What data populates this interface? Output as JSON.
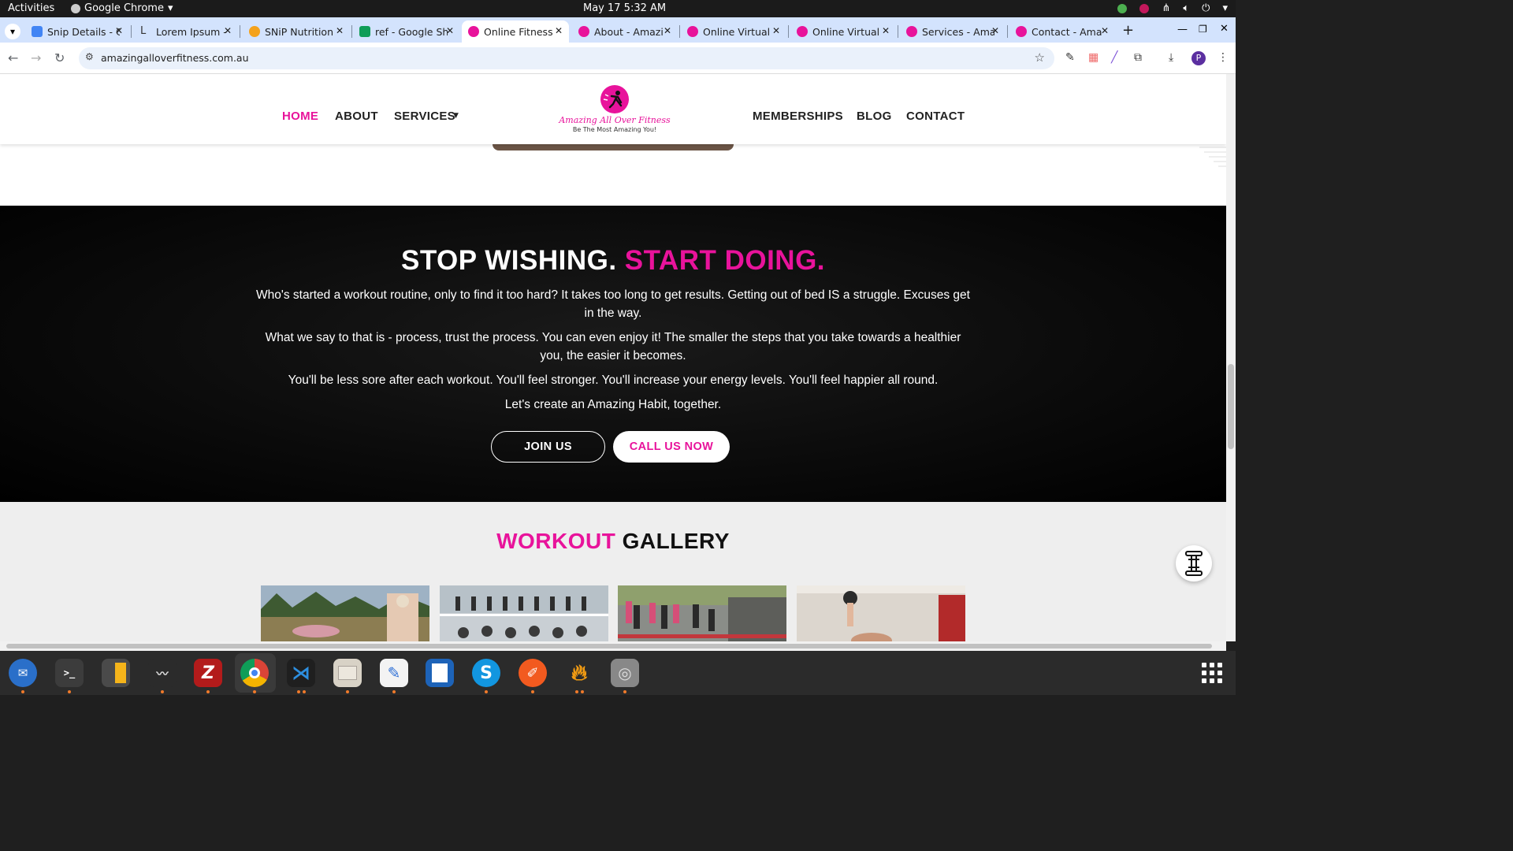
{
  "system": {
    "activities": "Activities",
    "app_name": "Google Chrome",
    "clock": "May 17  5:32 AM"
  },
  "browser": {
    "tabs": [
      {
        "title": "Snip Details - C",
        "icon": "docs-icon",
        "color": "#4285f4"
      },
      {
        "title": "Lorem Ipsum -",
        "icon": "lorem-icon",
        "color": "#555555"
      },
      {
        "title": "SNiP Nutrition",
        "icon": "snip-icon",
        "color": "#f4a21c"
      },
      {
        "title": "ref - Google Sh",
        "icon": "sheets-icon",
        "color": "#0f9d58"
      },
      {
        "title": "Online Fitness",
        "icon": "site-icon",
        "color": "#e8139b"
      },
      {
        "title": "About - Amazi",
        "icon": "site-icon",
        "color": "#e8139b"
      },
      {
        "title": "Online Virtual",
        "icon": "site-icon",
        "color": "#e8139b"
      },
      {
        "title": "Online Virtual",
        "icon": "site-icon",
        "color": "#e8139b"
      },
      {
        "title": "Services - Ama",
        "icon": "site-icon",
        "color": "#e8139b"
      },
      {
        "title": "Contact - Ama",
        "icon": "site-icon",
        "color": "#e8139b"
      }
    ],
    "active_tab": 4,
    "url": "amazingalloverfitness.com.au",
    "profile_initial": "P"
  },
  "site": {
    "nav": {
      "home": "HOME",
      "about": "ABOUT",
      "services": "SERVICES",
      "memberships": "MEMBERSHIPS",
      "blog": "BLOG",
      "contact": "CONTACT"
    },
    "logo": {
      "name": "Amazing All Over Fitness",
      "tagline": "Be The Most Amazing You!"
    },
    "cta": {
      "heading_white": "STOP WISHING.",
      "heading_pink": "START DOING.",
      "paragraphs": [
        "Who's started a workout routine, only to find it too hard? It takes too long to get results. Getting out of bed IS a struggle. Excuses get in the way.",
        "What we say to that is - process, trust the process. You can even enjoy it! The smaller the steps that you take towards a healthier you, the easier it becomes.",
        "You'll be less sore after each workout. You'll feel stronger. You'll increase your energy levels. You'll feel happier all round.",
        "Let's create an Amazing Habit, together."
      ],
      "join_label": "JOIN US",
      "call_label": "CALL US NOW"
    },
    "gallery": {
      "title_pink": "WORKOUT",
      "title_dark": "GALLERY"
    },
    "colors": {
      "accent": "#e8139b",
      "dark_section": "#000000",
      "gallery_bg": "#eeeeee"
    }
  }
}
